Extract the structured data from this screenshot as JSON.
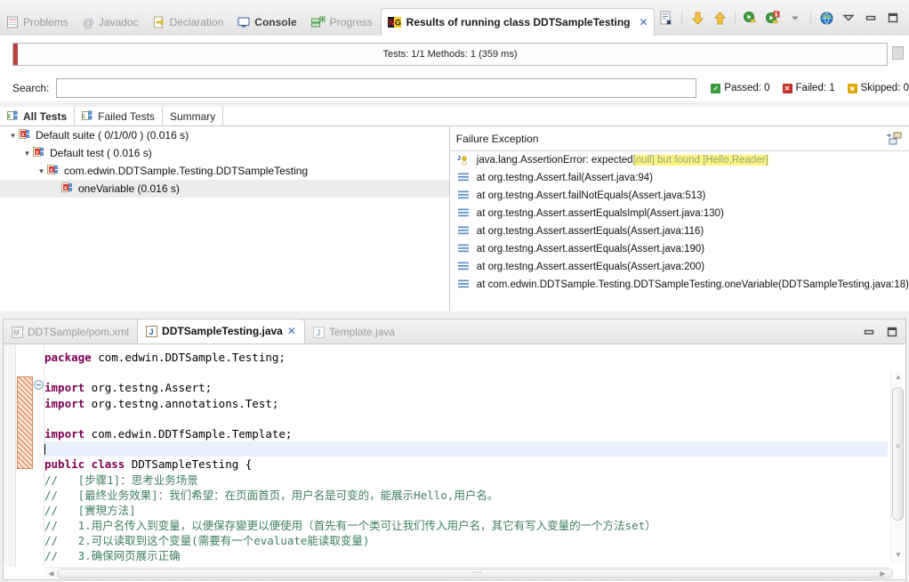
{
  "view_tabs": [
    {
      "label": "Problems",
      "icon": "problems-icon",
      "active": false,
      "bold": false
    },
    {
      "label": "Javadoc",
      "icon": "javadoc-icon",
      "active": false,
      "bold": false
    },
    {
      "label": "Declaration",
      "icon": "declaration-icon",
      "active": false,
      "bold": false
    },
    {
      "label": "Console",
      "icon": "console-icon",
      "active": false,
      "bold": true
    },
    {
      "label": "Progress",
      "icon": "progress-icon",
      "active": false,
      "bold": false
    },
    {
      "label": "Results of running class DDTSampleTesting",
      "icon": "testng-icon",
      "active": true,
      "bold": true,
      "close": "✕"
    }
  ],
  "view_toolbar": [
    {
      "name": "clear-results-icon",
      "title": "Clear"
    },
    {
      "name": "next-failure-icon",
      "title": "Next Failed Test"
    },
    {
      "name": "previous-failure-icon",
      "title": "Previous Failed Test"
    },
    {
      "name": "rerun-icon",
      "title": "Rerun"
    },
    {
      "name": "rerun-failed-icon",
      "title": "Rerun Failed Tests"
    },
    {
      "name": "view-menu-chevron-icon",
      "title": "View Menu"
    },
    {
      "name": "open-report-icon",
      "title": "Open Report"
    },
    {
      "name": "minimize-arrow-icon",
      "title": "Minimize"
    },
    {
      "name": "minimize-icon",
      "title": "Minimize"
    },
    {
      "name": "maximize-icon",
      "title": "Maximize"
    }
  ],
  "progress": {
    "status_text": "Tests: 1/1  Methods: 1 (359 ms)",
    "fill_color": "#b94040",
    "percent": 100
  },
  "search": {
    "label": "Search:",
    "value": "",
    "placeholder": ""
  },
  "counters": [
    {
      "name": "passed",
      "label": "Passed: 0",
      "color": "#3a9c3a",
      "glyph": "✓"
    },
    {
      "name": "failed",
      "label": "Failed: 1",
      "color": "#c4302b",
      "glyph": "✕"
    },
    {
      "name": "skipped",
      "label": "Skipped: 0",
      "color": "#e0a800",
      "glyph": "■"
    }
  ],
  "result_tabs": [
    {
      "label": "All Tests",
      "active": true
    },
    {
      "label": "Failed Tests",
      "active": false
    },
    {
      "label": "Summary",
      "active": false
    }
  ],
  "tree": [
    {
      "label": "Default suite ( 0/1/0/0 ) (0.016 s)",
      "indent": 0,
      "arrow": "▼",
      "selected": false
    },
    {
      "label": "Default test ( 0.016 s)",
      "indent": 1,
      "arrow": "▼",
      "selected": false
    },
    {
      "label": "com.edwin.DDTSample.Testing.DDTSampleTesting",
      "indent": 2,
      "arrow": "▼",
      "selected": false
    },
    {
      "label": "oneVariable  (0.016 s)",
      "indent": 3,
      "arrow": "",
      "selected": true
    }
  ],
  "exception": {
    "title": "Failure Exception",
    "toolbar_icon": "compare-layout-icon",
    "header_prefix": "java.lang.AssertionError: expected ",
    "header_highlight": "[null] but found [Hello,Reader]",
    "highlight_bg": "#fcf67f",
    "stack": [
      "at org.testng.Assert.fail(Assert.java:94)",
      "at org.testng.Assert.failNotEquals(Assert.java:513)",
      "at org.testng.Assert.assertEqualsImpl(Assert.java:130)",
      "at org.testng.Assert.assertEquals(Assert.java:116)",
      "at org.testng.Assert.assertEquals(Assert.java:190)",
      "at org.testng.Assert.assertEquals(Assert.java:200)",
      "at com.edwin.DDTSample.Testing.DDTSampleTesting.oneVariable(DDTSampleTesting.java:18)"
    ]
  },
  "editor": {
    "tabs": [
      {
        "label": "DDTSample/pom.xml",
        "icon": "maven-file-icon",
        "active": false
      },
      {
        "label": "DDTSampleTesting.java",
        "icon": "java-file-icon",
        "active": true,
        "close": "✕"
      },
      {
        "label": "Template.java",
        "icon": "java-file-icon",
        "active": false
      }
    ],
    "window_buttons": [
      {
        "name": "editor-minimize-icon"
      },
      {
        "name": "editor-maximize-icon"
      }
    ],
    "code": [
      {
        "type": "code",
        "parts": [
          {
            "t": "kw",
            "s": "package"
          },
          {
            "t": "pl",
            "s": " com.edwin.DDTSample.Testing;"
          }
        ]
      },
      {
        "type": "blank",
        "parts": []
      },
      {
        "type": "code",
        "parts": [
          {
            "t": "kw",
            "s": "import"
          },
          {
            "t": "pl",
            "s": " org.testng.Assert;"
          }
        ]
      },
      {
        "type": "code",
        "parts": [
          {
            "t": "kw",
            "s": "import"
          },
          {
            "t": "pl",
            "s": " org.testng.annotations.Test;"
          }
        ]
      },
      {
        "type": "blank",
        "parts": []
      },
      {
        "type": "code",
        "parts": [
          {
            "t": "kw",
            "s": "import"
          },
          {
            "t": "pl",
            "s": " com.edwin.DDTfSample.Template;"
          }
        ]
      },
      {
        "type": "caret",
        "parts": []
      },
      {
        "type": "code",
        "parts": [
          {
            "t": "kw",
            "s": "public class"
          },
          {
            "t": "pl",
            "s": " DDTSampleTesting {"
          }
        ]
      },
      {
        "type": "code",
        "parts": [
          {
            "t": "cm",
            "s": "//   [步骤1]：思考业务场景"
          }
        ]
      },
      {
        "type": "code",
        "parts": [
          {
            "t": "cm",
            "s": "//   [最终业务效果]：我们希望：在页面首页，用户名是可变的，能展示Hello,用户名。"
          }
        ]
      },
      {
        "type": "code",
        "parts": [
          {
            "t": "cm",
            "s": "//   [實現方法]"
          }
        ]
      },
      {
        "type": "code",
        "parts": [
          {
            "t": "cm",
            "s": "//   1.用户名传入到变量，以便保存變更以便使用（首先有一个类可让我们传入用户名，其它有写入变量的一个方法set）"
          }
        ]
      },
      {
        "type": "code",
        "parts": [
          {
            "t": "cm",
            "s": "//   2.可以读取到这个变量(需要有一个evaluate能读取变量)"
          }
        ]
      },
      {
        "type": "code",
        "parts": [
          {
            "t": "cm",
            "s": "//   3.确保网页展示正确"
          }
        ]
      }
    ]
  }
}
